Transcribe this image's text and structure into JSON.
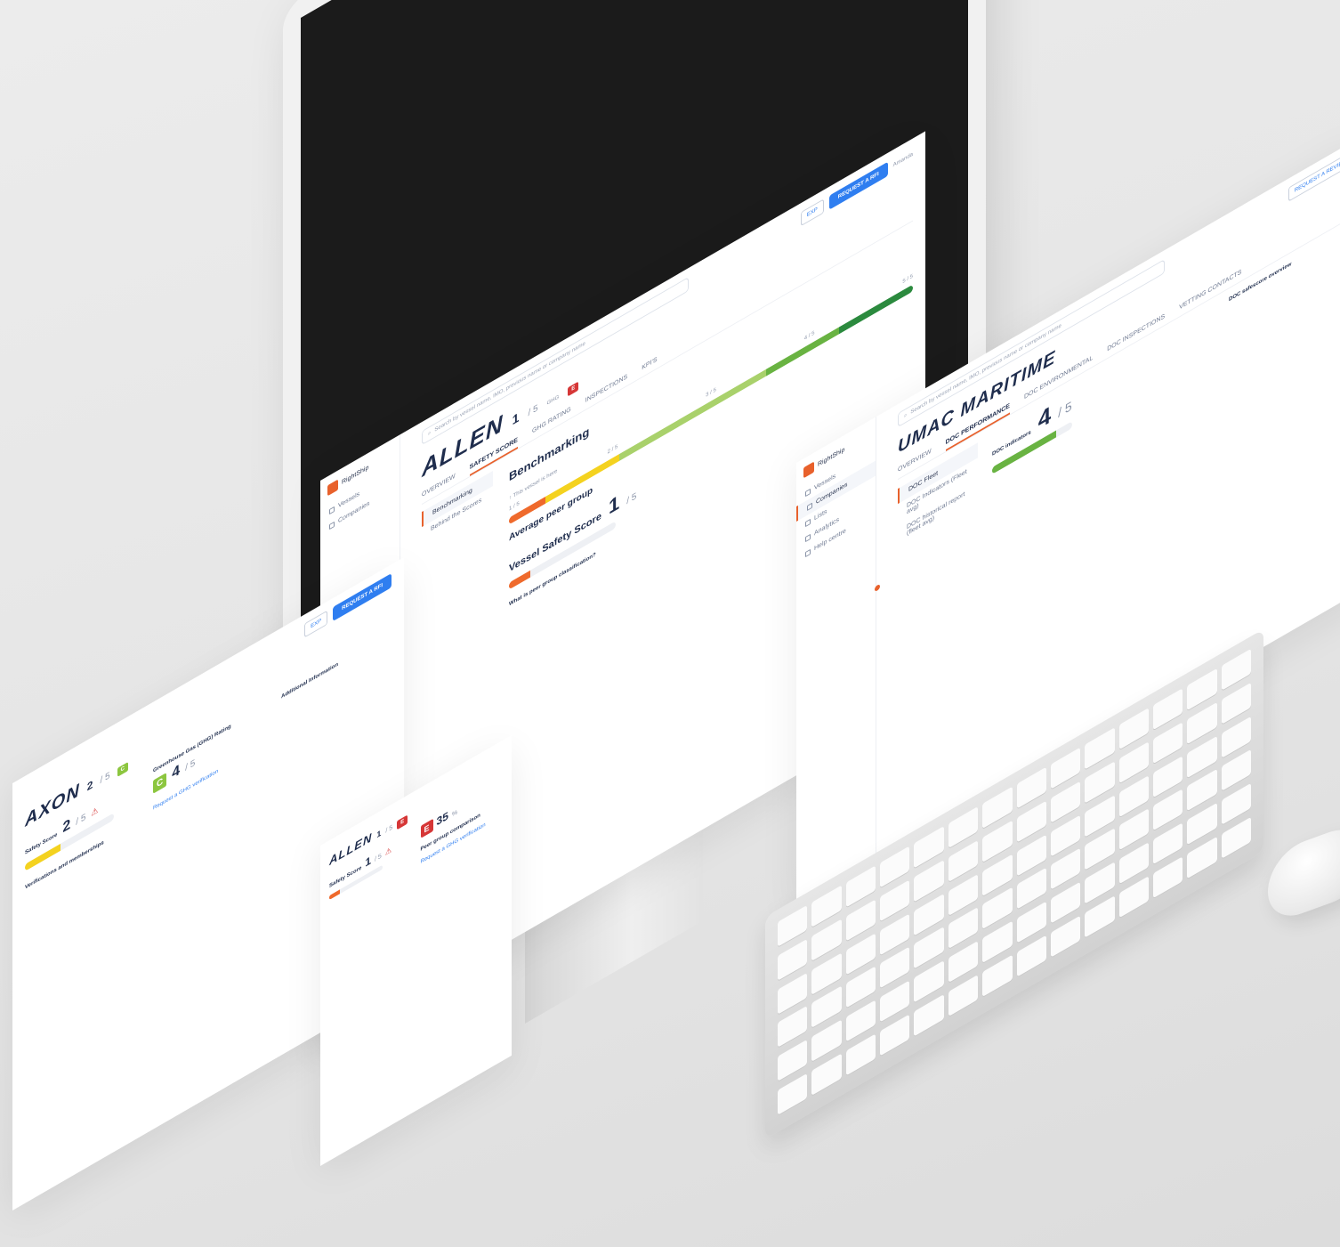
{
  "logo_text": "RightShip",
  "search_placeholder": "Search by vessel name, IMO, previous name or company name",
  "monitor_app": {
    "vessel_name": "ALLEN",
    "rating": "1",
    "rating_total": "/ 5",
    "ghg_label": "GHG",
    "ghg_value": "E",
    "tabs": [
      "OVERVIEW",
      "SAFETY SCORE",
      "GHG RATING",
      "INSPECTIONS",
      "KPI'S"
    ],
    "active_tab": "SAFETY SCORE",
    "side_nav": [
      "Vessels",
      "Companies"
    ],
    "side_sub": [
      "Benchmarking",
      "Behind the Scores"
    ],
    "section_benchmarking": "Benchmarking",
    "this_vessel": "This vessel is here",
    "average_peer_group": "Average peer group",
    "vessel_safety_score": "Vessel Safety Score",
    "score_value": "1",
    "score_total": "/ 5",
    "peer_group_question": "What is peer group classification?",
    "band_values": [
      "1 / 5",
      "2 / 5",
      "3 / 5",
      "4 / 5",
      "5 / 5"
    ],
    "request_button": "REQUEST A RFI",
    "ghost_button": "EXP",
    "user_label": "Amanda"
  },
  "left_app": {
    "vessel_name": "AXON",
    "rating": "2",
    "rating_total": "/ 5",
    "ghg_value": "C",
    "ghg_score": "4",
    "ghg_unit": "/ 5",
    "section_overview": "Greenhouse Gas (GHG) Rating",
    "safety_label": "Safety Score",
    "safety_value": "2",
    "safety_total": "/ 5",
    "verifications": "Verifications and memberships",
    "additional_info": "Additional Information",
    "link_text": "Request a GHG verification"
  },
  "center_app": {
    "vessel_name": "ALLEN",
    "rating": "1",
    "rating_total": "/ 5",
    "ghg_value": "E",
    "ghg_score": "35",
    "ghg_unit": "%",
    "safety_label": "Safety Score",
    "safety_value": "1",
    "safety_total": "/ 5",
    "peer_group": "Peer group comparison",
    "link_text": "Request a GHG verification"
  },
  "right_app": {
    "company_name": "UMAC MARITIME",
    "tabs": [
      "OVERVIEW",
      "DOC PERFORMANCE",
      "DOC ENVIRONMENTAL",
      "DOC INSPECTIONS",
      "VETTING CONTACTS"
    ],
    "active_tab": "DOC PERFORMANCE",
    "doc_indicators": "DOC indicators",
    "score_value": "4",
    "score_total": "/ 5",
    "side_nav": [
      "Vessels",
      "Companies",
      "Lists",
      "Analytics",
      "Help centre"
    ],
    "doc_list": [
      "DOC Fleet",
      "DOC Indicators (Fleet avg)",
      "DOC historical report (fleet avg)"
    ],
    "overview_title": "DOC safescore overview",
    "request_button": "REQUEST A REVIEW"
  },
  "colors": {
    "accent": "#e8612c",
    "primary": "#2f7ef0",
    "band_red": "#ef6a2c",
    "band_yellow": "#f4d21f",
    "band_lightgreen": "#a9d16b",
    "band_green": "#69b342",
    "band_darkgreen": "#2b8a3e"
  }
}
